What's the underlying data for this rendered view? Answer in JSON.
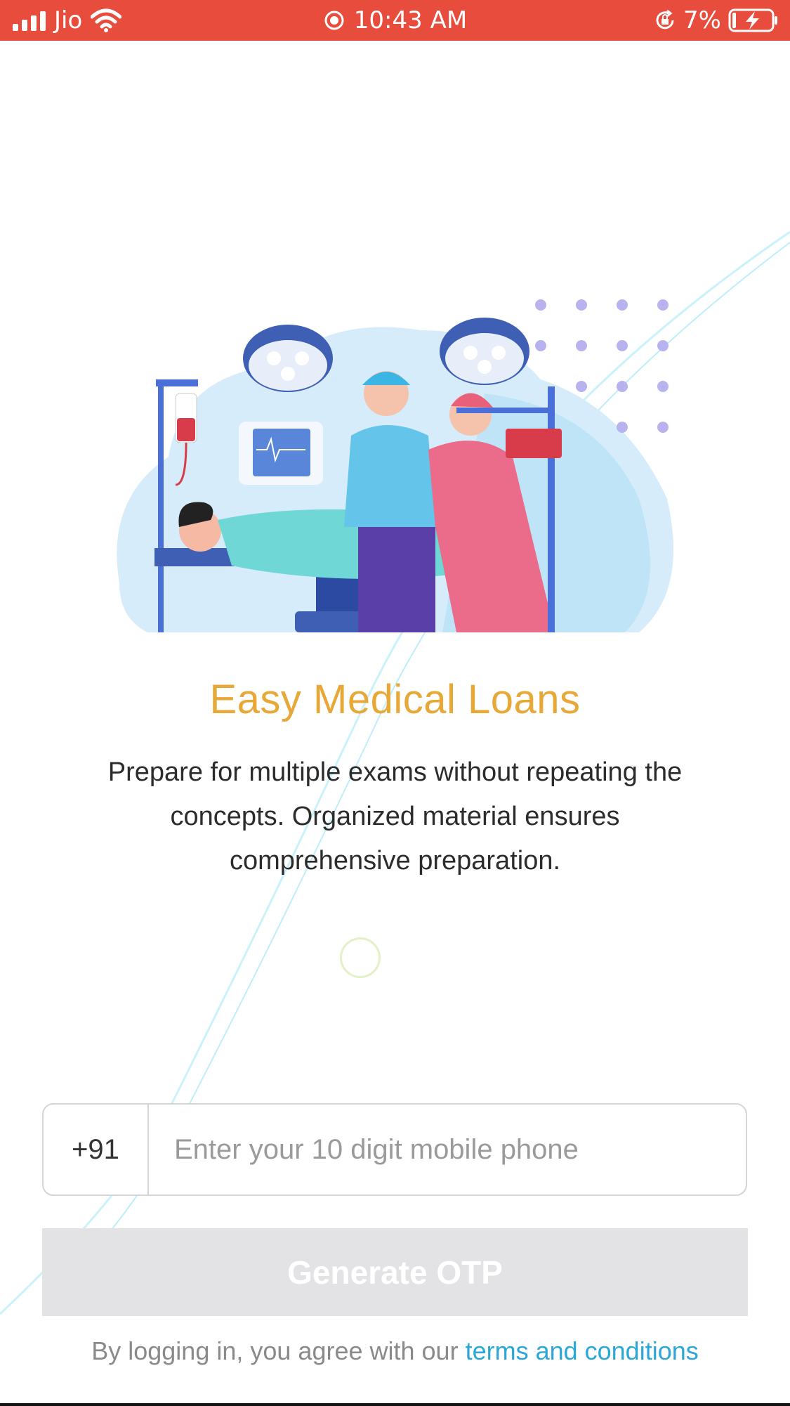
{
  "status_bar": {
    "carrier": "Jio",
    "time": "10:43 AM",
    "battery": "7%",
    "background_color": "#E74C3C",
    "icons": [
      "signal-bars-icon",
      "wifi-icon",
      "record-dot-icon",
      "rotation-lock-icon",
      "battery-charging-icon"
    ]
  },
  "hero": {
    "illustration": "surgery-illustration",
    "title": "Easy Medical Loans",
    "description": "Prepare for multiple exams without repeating the concepts. Organized material ensures comprehensive preparation.",
    "title_color": "#E8A838"
  },
  "login": {
    "country_code": "+91",
    "phone_placeholder": "Enter your 10 digit mobile phone",
    "phone_value": "",
    "generate_button_label": "Generate OTP",
    "terms_prefix": "By logging in, you agree with our ",
    "terms_link": "terms and conditions",
    "link_color": "#2aa7d8",
    "button_color": "#e3e2e5"
  }
}
